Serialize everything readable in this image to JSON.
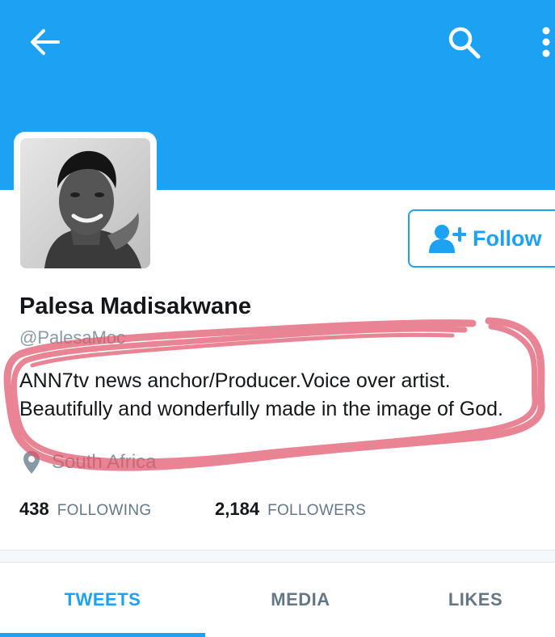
{
  "colors": {
    "accent": "#1da1f2",
    "text_primary": "#14171a",
    "text_secondary": "#657786",
    "annotation_marker": "#e0566a"
  },
  "header": {
    "back_icon": "arrow-left-icon",
    "search_icon": "search-icon",
    "more_icon": "more-vertical-icon"
  },
  "profile": {
    "avatar_icon": "profile-photo",
    "follow_label": "Follow",
    "follow_icon": "add-user-icon",
    "name": "Palesa Madisakwane",
    "handle": "@PalesaMoc",
    "bio_line1": "ANN7tv news anchor/Producer.Voice over artist.",
    "bio_line2": "Beautifully and wonderfully made in the image of God.",
    "location_icon": "location-pin-icon",
    "location": "South Africa"
  },
  "stats": {
    "following_count": "438",
    "following_label": "FOLLOWING",
    "followers_count": "2,184",
    "followers_label": "FOLLOWERS"
  },
  "tabs": [
    {
      "label": "TWEETS",
      "active": true
    },
    {
      "label": "MEDIA",
      "active": false
    },
    {
      "label": "LIKES",
      "active": false
    }
  ]
}
